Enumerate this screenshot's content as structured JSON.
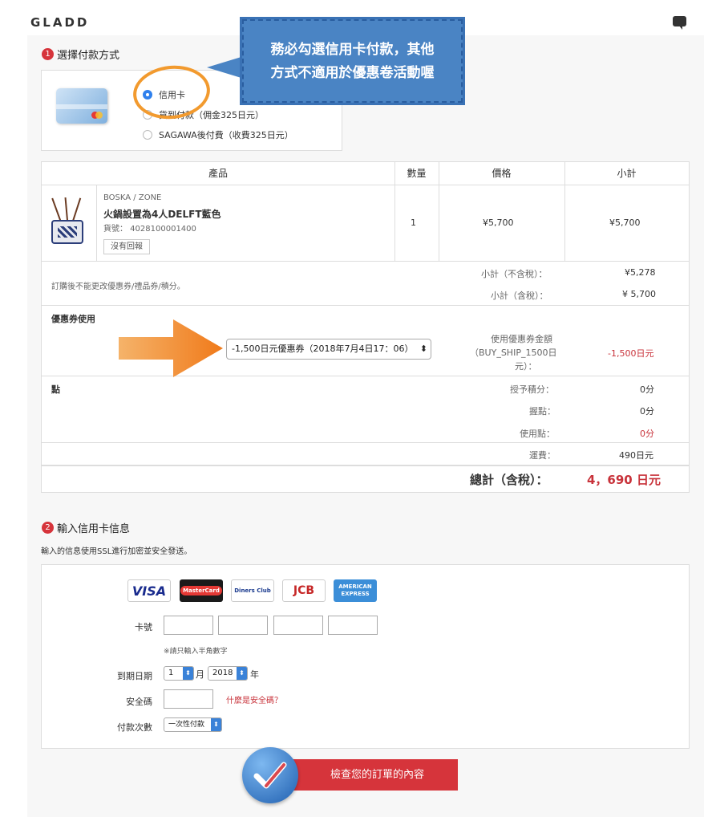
{
  "header": {
    "logo": "GLADD"
  },
  "section1": {
    "num": "1",
    "title": "選擇付款方式",
    "options": [
      {
        "label": "信用卡",
        "selected": true
      },
      {
        "label": "貨到付款（佣金325日元）",
        "selected": false
      },
      {
        "label": "SAGAWA後付費（收費325日元）",
        "selected": false
      }
    ]
  },
  "callout": {
    "line1": "務必勾選信用卡付款，其他",
    "line2": "方式不適用於優惠卷活動喔"
  },
  "table": {
    "headers": [
      "產品",
      "數量",
      "價格",
      "小計"
    ],
    "product": {
      "brand": "BOSKA / ZONE",
      "name": "火鍋設置為4人DELFT藍色",
      "sku": "貨號： 4028100001400",
      "review_label": "沒有回報",
      "qty": "1",
      "price": "¥5,700",
      "subtotal": "¥5,700"
    },
    "note": "訂購後不能更改優惠券/禮品券/積分。",
    "subtotal_ex_label": "小計（不含稅）：",
    "subtotal_ex_value": "¥5,278",
    "subtotal_in_label": "小計（含稅）：",
    "subtotal_in_value": "¥ 5,700",
    "coupon_title": "優惠券使用",
    "coupon_selected": "-1,500日元優惠券（2018年7月4日17：06）",
    "coupon_amount_label1": "使用優惠券金額",
    "coupon_amount_label2": "（BUY_SHIP_1500日",
    "coupon_amount_label3": "元）：",
    "coupon_amount_value": "-1,500日元",
    "points_title": "點",
    "points_awarded_label": "授予積分：",
    "points_awarded_value": "0分",
    "points_held_label": "握點：",
    "points_held_value": "0分",
    "points_used_label": "使用點：",
    "points_used_value": "0分",
    "shipping_label": "運費：",
    "shipping_value": "490日元",
    "total_label": "總計（含稅）：",
    "total_value": "4，690 日元"
  },
  "section2": {
    "num": "2",
    "title": "輸入信用卡信息",
    "ssl_note": "輸入的信息使用SSL進行加密並安全發送。",
    "brands": [
      "VISA",
      "MasterCard",
      "Diners Club",
      "JCB",
      "AMERICAN EXPRESS"
    ],
    "card_number_label": "卡號",
    "card_hint": "※請只輸入半角數字",
    "expiry_label": "到期日期",
    "expiry_month": "1",
    "month_unit": "月",
    "expiry_year": "2018",
    "year_unit": "年",
    "security_label": "安全碼",
    "security_link": "什麼是安全碼？",
    "installment_label": "付款次數",
    "installment_value": "一次性付款"
  },
  "submit": {
    "label": "檢查您的訂單的內容"
  },
  "colors": {
    "accent": "#d6343b",
    "callout": "#4a84c4",
    "highlight": "#f29a2e"
  }
}
